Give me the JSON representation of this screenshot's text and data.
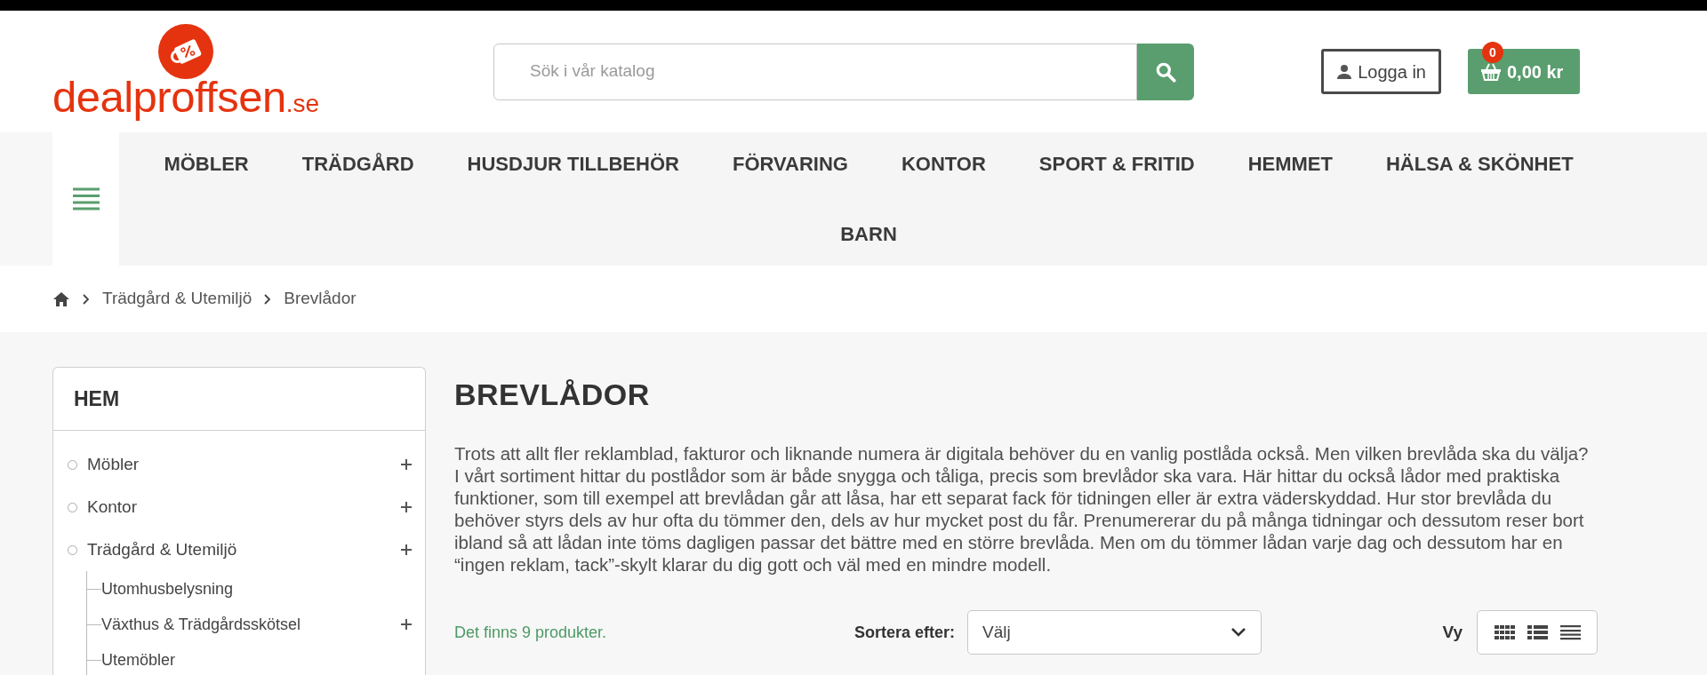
{
  "logo": {
    "name": "dealproffsen",
    "suffix": ".se"
  },
  "search": {
    "placeholder": "Sök i vår katalog"
  },
  "login": {
    "label": "Logga in"
  },
  "cart": {
    "count": "0",
    "total": "0,00 kr"
  },
  "nav": {
    "items": [
      "MÖBLER",
      "TRÄDGÅRD",
      "HUSDJUR TILLBEHÖR",
      "FÖRVARING",
      "KONTOR",
      "SPORT & FRITID",
      "HEMMET",
      "HÄLSA & SKÖNHET",
      "BARN"
    ]
  },
  "breadcrumb": [
    "Trädgård & Utemiljö",
    "Brevlådor"
  ],
  "sidebar": {
    "title": "HEM",
    "items": [
      {
        "label": "Möbler",
        "expandable": true
      },
      {
        "label": "Kontor",
        "expandable": true
      },
      {
        "label": "Trädgård & Utemiljö",
        "expandable": true,
        "children": [
          {
            "label": "Utomhusbelysning",
            "expandable": false
          },
          {
            "label": "Växthus & Trädgårdsskötsel",
            "expandable": true
          },
          {
            "label": "Utemöbler",
            "expandable": false
          }
        ]
      }
    ]
  },
  "category": {
    "title": "BREVLÅDOR",
    "description": "Trots att allt fler reklamblad, fakturor och liknande numera är digitala behöver du en vanlig postlåda också. Men vilken brevlåda ska du välja? I vårt sortiment hittar du postlådor som är både snygga och tåliga, precis som brevlådor ska vara. Här hittar du också lådor med praktiska funktioner, som till exempel att brevlådan går att låsa, har ett separat fack för tidningen eller är extra väderskyddad. Hur stor brevlåda du behöver styrs dels av hur ofta du tömmer den, dels av hur mycket post du får. Prenumererar du på många tidningar och dessutom reser bort ibland så att lådan inte töms dagligen passar det bättre med en större brevlåda. Men om du tömmer lådan varje dag och dessutom har en “ingen reklam, tack”-skylt klarar du dig gott och väl med en mindre modell."
  },
  "toolbar": {
    "count": "Det finns 9 produkter.",
    "sort_label": "Sortera efter:",
    "sort_value": "Välj",
    "view_label": "Vy",
    "views": [
      {
        "kind": "grid"
      },
      {
        "kind": "list"
      },
      {
        "kind": "table"
      }
    ]
  }
}
